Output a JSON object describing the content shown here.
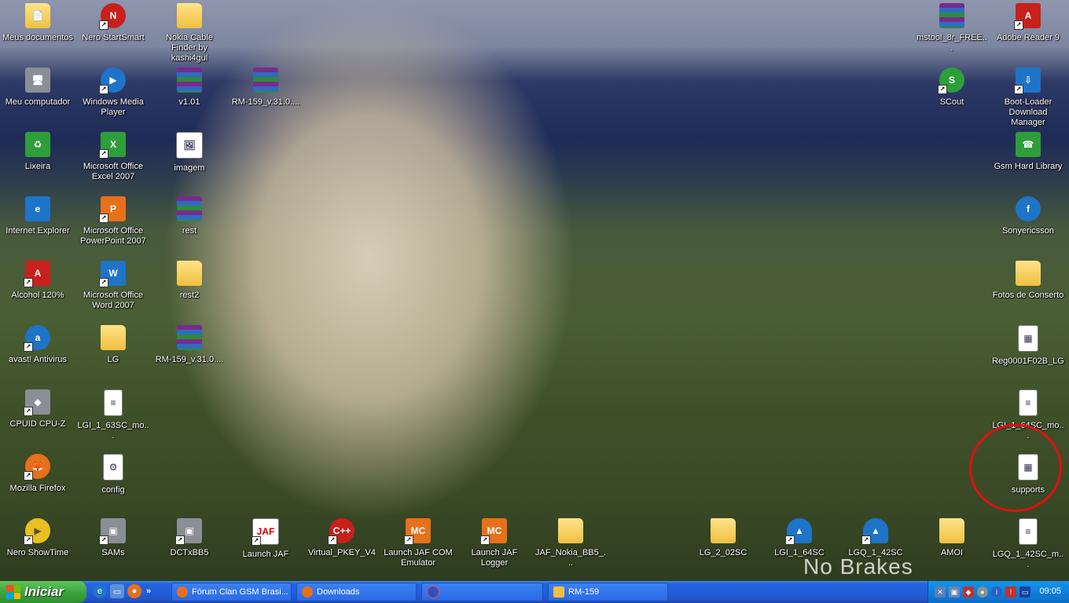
{
  "desktop": {
    "left_column_1": [
      {
        "label": "Meus documentos",
        "icon": "my-documents-folder-icon"
      },
      {
        "label": "Meu computador",
        "icon": "my-computer-icon"
      },
      {
        "label": "Lixeira",
        "icon": "recycle-bin-icon"
      },
      {
        "label": "Internet Explorer",
        "icon": "internet-explorer-icon"
      },
      {
        "label": "Alcohol 120%",
        "icon": "alcohol-120-icon"
      },
      {
        "label": "avast! Antivirus",
        "icon": "avast-icon"
      },
      {
        "label": "CPUID CPU-Z",
        "icon": "cpu-z-icon"
      },
      {
        "label": "Mozilla Firefox",
        "icon": "firefox-icon"
      },
      {
        "label": "Nero ShowTime",
        "icon": "nero-showtime-icon"
      }
    ],
    "left_column_2": [
      {
        "label": "Nero StartSmart",
        "icon": "nero-startsmart-icon"
      },
      {
        "label": "Windows Media Player",
        "icon": "windows-media-player-icon"
      },
      {
        "label": "Microsoft Office Excel 2007",
        "icon": "excel-icon"
      },
      {
        "label": "Microsoft Office PowerPoint 2007",
        "icon": "powerpoint-icon"
      },
      {
        "label": "Microsoft Office Word 2007",
        "icon": "word-icon"
      },
      {
        "label": "LG",
        "icon": "folder-icon"
      },
      {
        "label": "LGI_1_63SC_mo...",
        "icon": "text-file-icon"
      },
      {
        "label": "config",
        "icon": "config-file-icon"
      },
      {
        "label": "SAMs",
        "icon": "sams-icon"
      }
    ],
    "left_column_3": [
      {
        "label": "Nokia Cable Finder by kashi4gul",
        "icon": "folder-icon"
      },
      {
        "label": "v1.01",
        "icon": "winrar-archive-icon"
      },
      {
        "label": "imagem",
        "icon": "image-file-icon"
      },
      {
        "label": "rest",
        "icon": "winrar-archive-icon"
      },
      {
        "label": "rest2",
        "icon": "folder-icon"
      },
      {
        "label": "RM-159_v.31.0....",
        "icon": "winrar-archive-icon"
      },
      {
        "label": "DCTxBB5",
        "icon": "dctxbb5-icon"
      }
    ],
    "single_icons": {
      "rm159_top": {
        "label": "RM-159_v.31.0....",
        "icon": "winrar-archive-icon"
      }
    },
    "bottom_row": [
      {
        "label": "Launch JAF",
        "icon": "jaf-icon"
      },
      {
        "label": "Virtual_PKEY_V4",
        "icon": "virtual-pkey-icon"
      },
      {
        "label": "Launch JAF COM Emulator",
        "icon": "jaf-com-emulator-icon"
      },
      {
        "label": "Launch JAF Logger",
        "icon": "jaf-logger-icon"
      },
      {
        "label": "JAF_Nokia_BB5_...",
        "icon": "folder-icon"
      },
      {
        "label": "LG_2_02SC",
        "icon": "folder-icon"
      },
      {
        "label": "LGI_1_64SC",
        "icon": "lg-flash-icon"
      },
      {
        "label": "LGQ_1_42SC",
        "icon": "lg-flash-icon"
      },
      {
        "label": "AMOI",
        "icon": "folder-icon"
      },
      {
        "label": "LGQ_1_42SC_m...",
        "icon": "text-file-icon"
      }
    ],
    "right_column_2": [
      {
        "label": "mstool_8r_FREE...",
        "icon": "winrar-archive-icon"
      },
      {
        "label": "SCout",
        "icon": "scout-icon"
      }
    ],
    "right_column_1": [
      {
        "label": "Adobe Reader 9",
        "icon": "adobe-reader-icon"
      },
      {
        "label": "Boot-Loader Download Manager",
        "icon": "bootloader-icon"
      },
      {
        "label": "Gsm Hard Library",
        "icon": "gsm-hard-library-icon"
      },
      {
        "label": "Sonyericsson",
        "icon": "sonyericsson-icon"
      },
      {
        "label": "Fotos de Conserto",
        "icon": "folder-icon"
      },
      {
        "label": "Reg0001F02B_LG",
        "icon": "registry-file-icon"
      },
      {
        "label": "LGI_1_64SC_mo...",
        "icon": "text-file-icon"
      },
      {
        "label": "supports",
        "icon": "registry-file-icon"
      }
    ],
    "watermark": "No Brakes"
  },
  "taskbar": {
    "start_label": "Iniciar",
    "quick_launch": [
      "internet-explorer-icon",
      "show-desktop-icon",
      "firefox-icon"
    ],
    "quick_launch_more": "»",
    "tasks": [
      {
        "label": "Fórum Clan GSM Brasi...",
        "icon": "firefox-icon"
      },
      {
        "label": "Downloads",
        "icon": "firefox-icon"
      },
      {
        "label": "",
        "icon": "lg-flash-icon"
      },
      {
        "label": "RM-159",
        "icon": "folder-icon"
      }
    ],
    "clock": "09:05"
  },
  "colors": {
    "taskbar_blue": "#245edb",
    "start_green": "#3ea53e",
    "tray_blue": "#0f80dc",
    "annotation_red": "#e01010"
  }
}
